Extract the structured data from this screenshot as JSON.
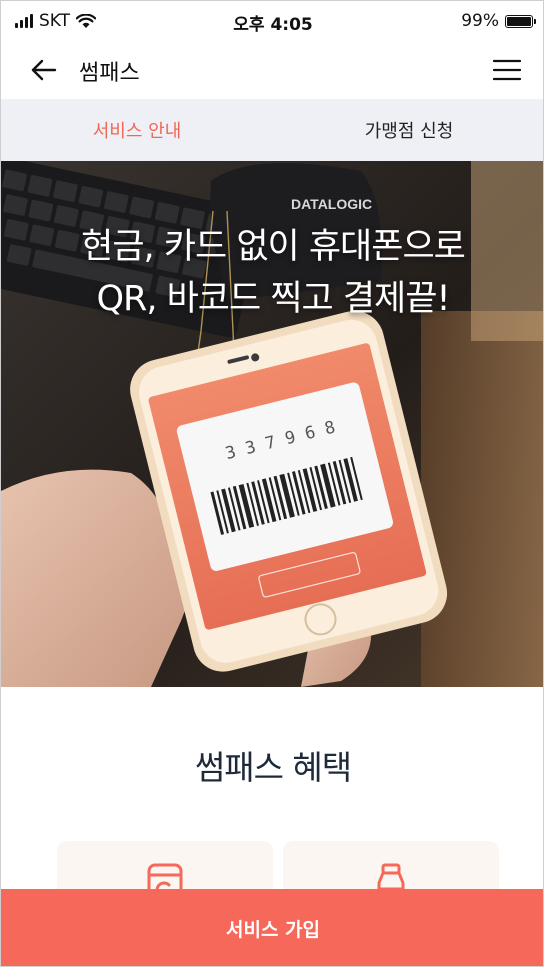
{
  "status_bar": {
    "carrier": "SKT",
    "time": "오후 4:05",
    "battery": "99%"
  },
  "header": {
    "title": "썸패스",
    "back_icon": "arrow-left-icon",
    "menu_icon": "hamburger-menu-icon"
  },
  "tabs": [
    {
      "label": "서비스 안내",
      "active": true
    },
    {
      "label": "가맹점 신청",
      "active": false
    }
  ],
  "hero": {
    "line1": "현금, 카드 없이 휴대폰으로",
    "line2": "QR, 바코드 찍고 결제끝!",
    "scanner_brand": "DATALOGIC",
    "phone_code": "3 3 7 9 6 8"
  },
  "benefits": {
    "title": "썸패스 혜택",
    "cards": [
      {
        "icon": "mobile-coin-icon"
      },
      {
        "icon": "bottle-icon"
      }
    ]
  },
  "cta": {
    "label": "서비스 가입"
  },
  "colors": {
    "accent": "#f5685a",
    "tab_active": "#f06757",
    "tab_bg": "#eef0f5"
  }
}
